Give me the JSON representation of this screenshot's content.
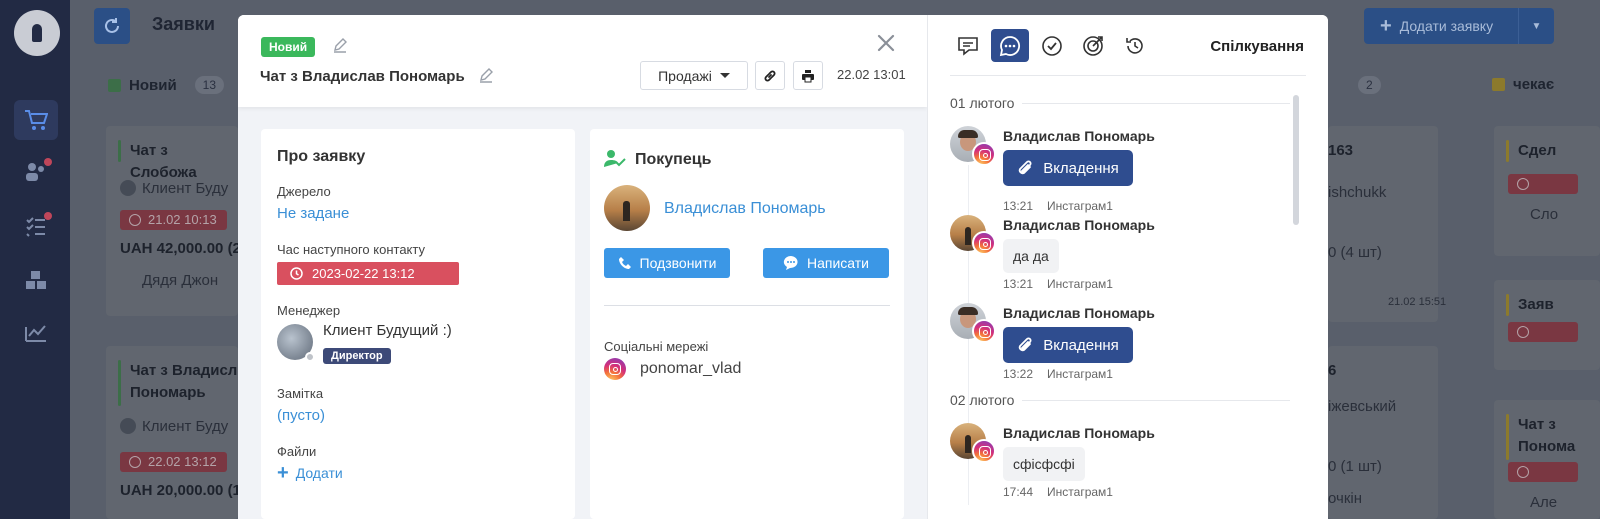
{
  "background": {
    "page_title": "Заявки",
    "add_button_label": "Додати заявку",
    "columns": [
      {
        "name": "Новий",
        "count": "13",
        "color": "#3c6e48"
      },
      {
        "name": "",
        "count": "2",
        "color": "#3c6e48"
      },
      {
        "name": "чекає",
        "count": "",
        "color": "#8c7a2c"
      }
    ],
    "cards_left": [
      {
        "title": "Чат з Слобожа",
        "client": "Клиент Буду",
        "date": "21.02 10:13",
        "amount": "UAH 42,000.00 (2",
        "manager": "Дядя Джон"
      },
      {
        "title": "Чат з Владисл Пономарь",
        "client": "Клиент Буду",
        "date": "22.02 13:12",
        "amount": "UAH 20,000.00 (1"
      }
    ],
    "cards_mid": [
      {
        "l1": "163",
        "l2": "ishchukk",
        "l3": "0 (4 шт)",
        "l4": "21.02 15:51"
      },
      {
        "l1": "6",
        "l2": "іжевський",
        "l3": "0 (1 шт)",
        "l4": "очкін"
      }
    ],
    "cards_right": [
      {
        "title": "Сдел",
        "line": "Сло"
      },
      {
        "title": "Заяв"
      },
      {
        "title": "Чат з Понома",
        "line": "Але"
      }
    ]
  },
  "modal": {
    "status_badge": "Новий",
    "title": "Чат з Владислав Пономарь",
    "pipeline_select": "Продажі",
    "date": "22.02 13:01",
    "about": {
      "heading": "Про заявку",
      "source_label": "Джерело",
      "source_value": "Не задане",
      "next_contact_label": "Час наступного контакту",
      "next_contact_value": "2023-02-22 13:12",
      "manager_label": "Менеджер",
      "manager_name": "Клиент Будущий :)",
      "manager_role": "Директор",
      "note_label": "Замітка",
      "note_value": "(пусто)",
      "files_label": "Файли",
      "files_add": "Додати"
    },
    "buyer": {
      "heading": "Покупець",
      "name": "Владислав Пономарь",
      "call_button": "Подзвонити",
      "write_button": "Написати",
      "social_label": "Соціальні мережі",
      "social_handle": "ponomar_vlad"
    },
    "chat": {
      "heading": "Спілкування",
      "tabs": [
        "comment-icon",
        "chat-icon",
        "check-icon",
        "target-icon",
        "history-icon"
      ],
      "dates": [
        "01 лютого",
        "02 лютого"
      ],
      "messages": [
        {
          "author": "Владислав Пономарь",
          "type": "attachment",
          "text": "Вкладення",
          "time": "13:21",
          "channel": "Инстаграм1"
        },
        {
          "author": "Владислав Пономарь",
          "type": "text",
          "text": "да да",
          "time": "13:21",
          "channel": "Инстаграм1"
        },
        {
          "author": "Владислав Пономарь",
          "type": "attachment",
          "text": "Вкладення",
          "time": "13:22",
          "channel": "Инстаграм1"
        },
        {
          "author": "Владислав Пономарь",
          "type": "text",
          "text": "сфісфсфі",
          "time": "17:44",
          "channel": "Инстаграм1"
        }
      ]
    }
  },
  "colors": {
    "accent_blue": "#3b97e6",
    "navy": "#2f4d8f",
    "status_green": "#3bb85c",
    "alert_red": "#d9505f"
  }
}
